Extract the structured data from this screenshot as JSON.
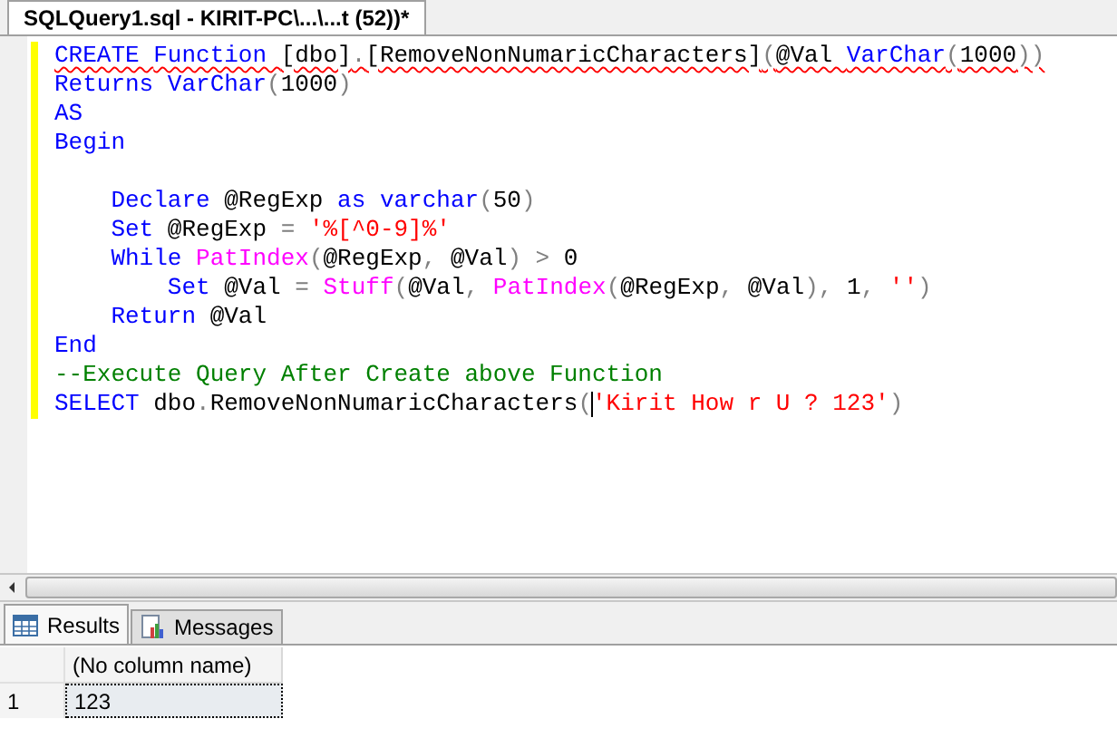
{
  "document_tab": {
    "title": "SQLQuery1.sql - KIRIT-PC\\...\\...t (52))*",
    "modified": true
  },
  "editor": {
    "lines": [
      {
        "kind": "code",
        "error": true,
        "tokens": [
          {
            "text": "CREATE ",
            "kind": "keyword"
          },
          {
            "text": "Function ",
            "kind": "keyword"
          },
          {
            "text": "[dbo]",
            "kind": "plain"
          },
          {
            "text": ".",
            "kind": "operator"
          },
          {
            "text": "[RemoveNonNumaricCharacters]",
            "kind": "plain"
          },
          {
            "text": "(",
            "kind": "operator"
          },
          {
            "text": "@Val ",
            "kind": "plain"
          },
          {
            "text": "VarChar",
            "kind": "keyword"
          },
          {
            "text": "(",
            "kind": "operator"
          },
          {
            "text": "1000",
            "kind": "plain"
          },
          {
            "text": "))",
            "kind": "operator"
          }
        ]
      },
      {
        "kind": "code",
        "error": false,
        "tokens": [
          {
            "text": "Returns ",
            "kind": "keyword"
          },
          {
            "text": "VarChar",
            "kind": "keyword"
          },
          {
            "text": "(",
            "kind": "operator"
          },
          {
            "text": "1000",
            "kind": "plain"
          },
          {
            "text": ")",
            "kind": "operator"
          }
        ]
      },
      {
        "kind": "code",
        "error": false,
        "tokens": [
          {
            "text": "AS",
            "kind": "keyword"
          }
        ]
      },
      {
        "kind": "code",
        "error": false,
        "tokens": [
          {
            "text": "Begin",
            "kind": "keyword"
          }
        ]
      },
      {
        "kind": "blank"
      },
      {
        "kind": "code",
        "error": false,
        "tokens": [
          {
            "text": "    Declare",
            "kind": "keyword"
          },
          {
            "text": " @RegExp ",
            "kind": "plain"
          },
          {
            "text": "as ",
            "kind": "keyword"
          },
          {
            "text": "varchar",
            "kind": "keyword"
          },
          {
            "text": "(",
            "kind": "operator"
          },
          {
            "text": "50",
            "kind": "plain"
          },
          {
            "text": ")",
            "kind": "operator"
          }
        ]
      },
      {
        "kind": "code",
        "error": false,
        "tokens": [
          {
            "text": "    Set",
            "kind": "keyword"
          },
          {
            "text": " @RegExp ",
            "kind": "plain"
          },
          {
            "text": "= ",
            "kind": "operator"
          },
          {
            "text": "'%[^0-9]%'",
            "kind": "string"
          }
        ]
      },
      {
        "kind": "code",
        "error": false,
        "tokens": [
          {
            "text": "    While ",
            "kind": "keyword"
          },
          {
            "text": "PatIndex",
            "kind": "function"
          },
          {
            "text": "(",
            "kind": "operator"
          },
          {
            "text": "@RegExp",
            "kind": "plain"
          },
          {
            "text": ",",
            "kind": "operator"
          },
          {
            "text": " @Val",
            "kind": "plain"
          },
          {
            "text": ") >",
            "kind": "operator"
          },
          {
            "text": " 0",
            "kind": "plain"
          }
        ]
      },
      {
        "kind": "code",
        "error": false,
        "tokens": [
          {
            "text": "        Set",
            "kind": "keyword"
          },
          {
            "text": " @Val ",
            "kind": "plain"
          },
          {
            "text": "= ",
            "kind": "operator"
          },
          {
            "text": "Stuff",
            "kind": "function"
          },
          {
            "text": "(",
            "kind": "operator"
          },
          {
            "text": "@Val",
            "kind": "plain"
          },
          {
            "text": ", ",
            "kind": "operator"
          },
          {
            "text": "PatIndex",
            "kind": "function"
          },
          {
            "text": "(",
            "kind": "operator"
          },
          {
            "text": "@RegExp",
            "kind": "plain"
          },
          {
            "text": ",",
            "kind": "operator"
          },
          {
            "text": " @Val",
            "kind": "plain"
          },
          {
            "text": "),",
            "kind": "operator"
          },
          {
            "text": " 1",
            "kind": "plain"
          },
          {
            "text": ", ",
            "kind": "operator"
          },
          {
            "text": "''",
            "kind": "string"
          },
          {
            "text": ")",
            "kind": "operator"
          }
        ]
      },
      {
        "kind": "code",
        "error": false,
        "tokens": [
          {
            "text": "    Return",
            "kind": "keyword"
          },
          {
            "text": " @Val",
            "kind": "plain"
          }
        ]
      },
      {
        "kind": "code",
        "error": false,
        "tokens": [
          {
            "text": "End",
            "kind": "keyword"
          }
        ]
      },
      {
        "kind": "code",
        "error": false,
        "tokens": [
          {
            "text": "--Execute Query After Create above Function",
            "kind": "comment"
          }
        ]
      },
      {
        "kind": "code",
        "error": false,
        "tokens": [
          {
            "text": "SELECT",
            "kind": "keyword"
          },
          {
            "text": " dbo",
            "kind": "plain"
          },
          {
            "text": ".",
            "kind": "operator"
          },
          {
            "text": "RemoveNonNumaricCharacters",
            "kind": "plain"
          },
          {
            "text": "(",
            "kind": "operator",
            "caret_after": true
          },
          {
            "text": "'Kirit How r U ? 123'",
            "kind": "string"
          },
          {
            "text": ")",
            "kind": "operator"
          }
        ]
      }
    ]
  },
  "result_tabs": [
    {
      "label": "Results",
      "selected": true
    },
    {
      "label": "Messages",
      "selected": false
    }
  ],
  "grid": {
    "columns": [
      "(No column name)"
    ],
    "rows": [
      {
        "number": "1",
        "cells": [
          "123"
        ],
        "selected": true
      }
    ]
  }
}
